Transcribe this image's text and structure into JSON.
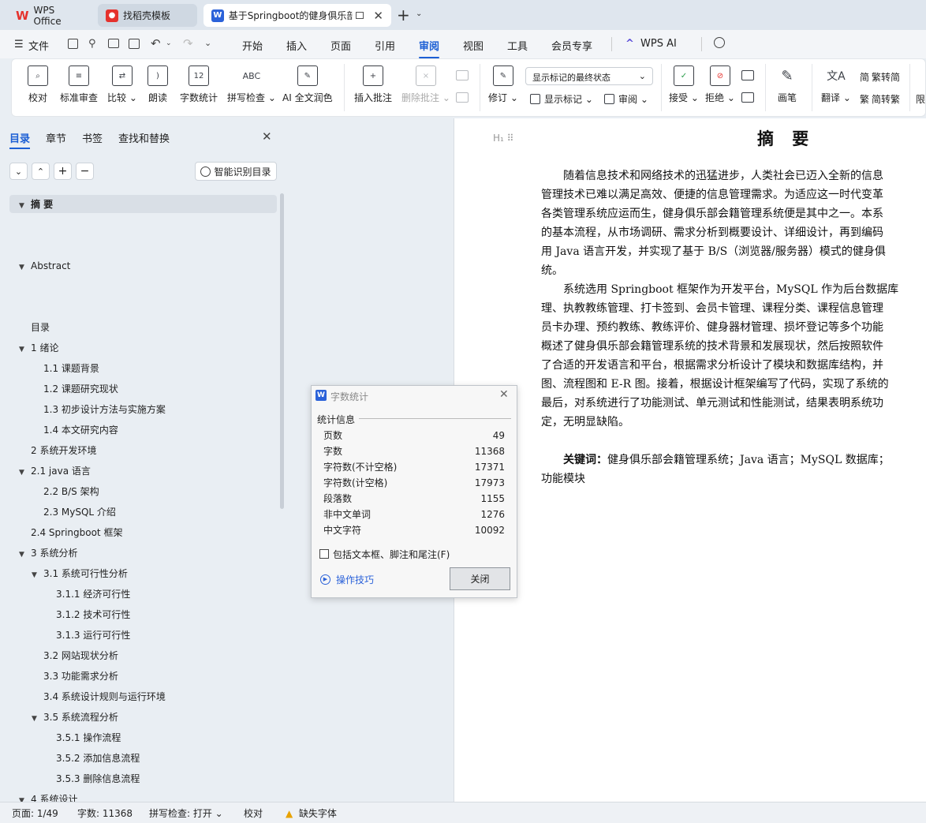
{
  "tabs": [
    {
      "label": "WPS Office"
    },
    {
      "label": "找稻壳模板"
    },
    {
      "label": "基于Springboot的健身俱乐部"
    }
  ],
  "menu": {
    "file": "文件",
    "items": [
      "开始",
      "插入",
      "页面",
      "引用",
      "审阅",
      "视图",
      "工具",
      "会员专享"
    ],
    "active": "审阅",
    "ai": "WPS AI"
  },
  "ribbon": {
    "proofread": "校对",
    "std_review": "标准审查",
    "compare": "比较",
    "read_aloud": "朗读",
    "word_count": "字数统计",
    "spell_check": "拼写检查",
    "ai_polish": "AI 全文润色",
    "insert_comment": "插入批注",
    "delete_comment": "删除批注",
    "track": "修订",
    "show_markup_select": "显示标记的最终状态",
    "show_markup": "显示标记",
    "review": "审阅",
    "accept": "接受",
    "reject": "拒绝",
    "pen": "画笔",
    "translate": "翻译",
    "to_simplified": "繁转简",
    "to_traditional": "简转繁",
    "limit": "限"
  },
  "left": {
    "tabs": [
      "目录",
      "章节",
      "书签",
      "查找和替换"
    ],
    "smart_btn": "智能识别目录",
    "toc": [
      {
        "label": "摘 要",
        "level": 1,
        "arrow": true
      },
      {
        "label": "Abstract",
        "level": 1,
        "arrow": true
      },
      {
        "label": "目录",
        "level": 1,
        "arrow": false
      },
      {
        "label": "1  绪论",
        "level": 1,
        "arrow": true
      },
      {
        "label": "1.1  课题背景",
        "level": 2,
        "arrow": false
      },
      {
        "label": "1.2  课题研究现状",
        "level": 2,
        "arrow": false
      },
      {
        "label": "1.3  初步设计方法与实施方案",
        "level": 2,
        "arrow": false
      },
      {
        "label": "1.4  本文研究内容",
        "level": 2,
        "arrow": false
      },
      {
        "label": "2  系统开发环境",
        "level": 1,
        "arrow": false
      },
      {
        "label": "2.1 java 语言",
        "level": 1,
        "arrow": true
      },
      {
        "label": "2.2 B/S 架构",
        "level": 2,
        "arrow": false
      },
      {
        "label": "2.3 MySQL  介绍",
        "level": 2,
        "arrow": false
      },
      {
        "label": "2.4 Springboot 框架",
        "level": 1,
        "arrow": false
      },
      {
        "label": "3  系统分析",
        "level": 1,
        "arrow": true
      },
      {
        "label": "3.1  系统可行性分析",
        "level": 2,
        "arrow": true
      },
      {
        "label": "3.1.1  经济可行性",
        "level": 3,
        "arrow": false
      },
      {
        "label": "3.1.2  技术可行性",
        "level": 3,
        "arrow": false
      },
      {
        "label": "3.1.3  运行可行性",
        "level": 3,
        "arrow": false
      },
      {
        "label": "3.2  网站现状分析",
        "level": 2,
        "arrow": false
      },
      {
        "label": "3.3  功能需求分析",
        "level": 2,
        "arrow": false
      },
      {
        "label": "3.4  系统设计规则与运行环境",
        "level": 2,
        "arrow": false
      },
      {
        "label": "3.5 系统流程分析",
        "level": 2,
        "arrow": true
      },
      {
        "label": "3.5.1 操作流程",
        "level": 3,
        "arrow": false
      },
      {
        "label": "3.5.2 添加信息流程",
        "level": 3,
        "arrow": false
      },
      {
        "label": "3.5.3 删除信息流程",
        "level": 3,
        "arrow": false
      },
      {
        "label": "4  系统设计",
        "level": 1,
        "arrow": true
      }
    ]
  },
  "doc": {
    "title": "摘 要",
    "lines": [
      "　　随着信息技术和网络技术的迅猛进步，人类社会已迈入全新的信息",
      "管理技术已难以满足高效、便捷的信息管理需求。为适应这一时代变革",
      "各类管理系统应运而生，健身俱乐部会籍管理系统便是其中之一。本系",
      "的基本流程，从市场调研、需求分析到概要设计、详细设计，再到编码",
      "用 Java 语言开发，并实现了基于 B/S（浏览器/服务器）模式的健身俱",
      "统。",
      "　　系统选用 Springboot 框架作为开发平台，MySQL 作为后台数据库",
      "理、执教教练管理、打卡签到、会员卡管理、课程分类、课程信息管理",
      "员卡办理、预约教练、教练评价、健身器材管理、损坏登记等多个功能",
      "概述了健身俱乐部会籍管理系统的技术背景和发展现状，然后按照软件",
      "了合适的开发语言和平台，根据需求分析设计了模块和数据库结构，并",
      "图、流程图和 E-R 图。接着，根据设计框架编写了代码，实现了系统的",
      "最后，对系统进行了功能测试、单元测试和性能测试，结果表明系统功",
      "定，无明显缺陷。"
    ],
    "keywords_label": "　　关键词：",
    "keywords_text": "健身俱乐部会籍管理系统；Java 语言；MySQL 数据库；",
    "keywords_line2": "功能模块"
  },
  "dialog": {
    "title": "字数统计",
    "section": "统计信息",
    "rows": [
      {
        "k": "页数",
        "v": "49"
      },
      {
        "k": "字数",
        "v": "11368"
      },
      {
        "k": "字符数(不计空格)",
        "v": "17371"
      },
      {
        "k": "字符数(计空格)",
        "v": "17973"
      },
      {
        "k": "段落数",
        "v": "1155"
      },
      {
        "k": "非中文单词",
        "v": "1276"
      },
      {
        "k": "中文字符",
        "v": "10092"
      }
    ],
    "checkbox": "包括文本框、脚注和尾注(F)",
    "tips": "操作技巧",
    "close": "关闭"
  },
  "status": {
    "page": "页面: 1/49",
    "words": "字数: 11368",
    "spell": "拼写检查: 打开",
    "proof": "校对",
    "missing_font": "缺失字体"
  },
  "colors": {
    "accent": "#1c5fd4",
    "wps_red": "#e5322d"
  }
}
